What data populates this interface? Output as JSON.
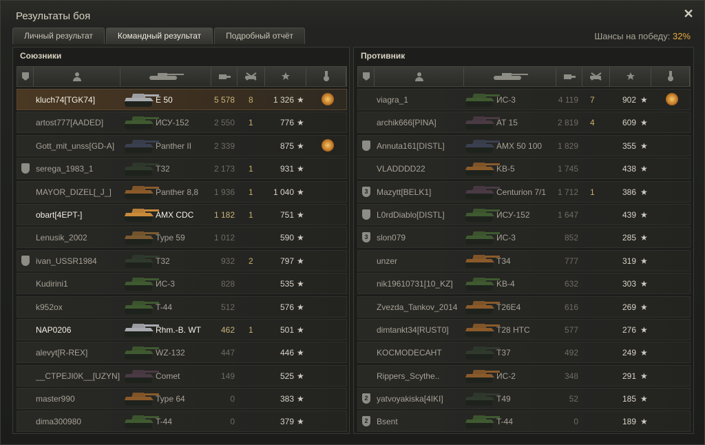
{
  "window": {
    "title": "Результаты боя",
    "close_icon": "close-icon"
  },
  "tabs": [
    {
      "label": "Личный результат",
      "active": false
    },
    {
      "label": "Командный результат",
      "active": true
    },
    {
      "label": "Подробный отчёт",
      "active": false
    }
  ],
  "win_chance": {
    "label": "Шансы на победу:",
    "value": "32%"
  },
  "allies": {
    "title": "Союзники",
    "rows": [
      {
        "name": "kluch74[TGK74]",
        "vehicle": "E 50",
        "damage": "5 578",
        "kills": "8",
        "xp": "1 326",
        "highlight": "self",
        "medal": true,
        "tank_color": "#a8aab0"
      },
      {
        "name": "artost777[AADED]",
        "vehicle": "ИСУ-152",
        "damage": "2 550",
        "kills": "1",
        "xp": "776",
        "tank_color": "#3f5a30"
      },
      {
        "name": "Gott_mit_unss[GD-A]",
        "vehicle": "Panther II",
        "damage": "2 339",
        "kills": "",
        "xp": "875",
        "medal": true,
        "tank_color": "#3a4050"
      },
      {
        "name": "serega_1983_1",
        "vehicle": "T32",
        "damage": "2 173",
        "kills": "1",
        "xp": "931",
        "badge": " ",
        "tank_color": "#2f3a2c"
      },
      {
        "name": "MAYOR_DIZEL[_J_]",
        "vehicle": "Panther 8,8",
        "damage": "1 936",
        "kills": "1",
        "xp": "1 040",
        "tank_color": "#8a5a2a"
      },
      {
        "name": "obart[4EPT-]",
        "vehicle": "AMX CDC",
        "damage": "1 182",
        "kills": "1",
        "xp": "751",
        "highlight": "bright",
        "tank_color": "#c98a3a"
      },
      {
        "name": "Lenusik_2002",
        "vehicle": "Type 59",
        "damage": "1 012",
        "kills": "",
        "xp": "590",
        "tank_color": "#7a5a30"
      },
      {
        "name": "ivan_USSR1984",
        "vehicle": "T32",
        "damage": "932",
        "kills": "2",
        "xp": "797",
        "badge": " ",
        "tank_color": "#2f3a2c"
      },
      {
        "name": "Kudirini1",
        "vehicle": "ИС-3",
        "damage": "828",
        "kills": "",
        "xp": "535",
        "tank_color": "#3f5a30"
      },
      {
        "name": "k952ox",
        "vehicle": "T-44",
        "damage": "512",
        "kills": "",
        "xp": "576",
        "tank_color": "#3f5a30"
      },
      {
        "name": "NAP0206",
        "vehicle": "Rhm.-B. WT",
        "damage": "462",
        "kills": "1",
        "xp": "501",
        "highlight": "bright",
        "tank_color": "#a8aab0"
      },
      {
        "name": "alevyt[R-REX]",
        "vehicle": "WZ-132",
        "damage": "447",
        "kills": "",
        "xp": "446",
        "tank_color": "#3f5a30"
      },
      {
        "name": "__CTPEJI0K__[UZYN]",
        "vehicle": "Comet",
        "damage": "149",
        "kills": "",
        "xp": "525",
        "tank_color": "#4a3a44"
      },
      {
        "name": "master990",
        "vehicle": "Type 64",
        "damage": "0",
        "kills": "",
        "xp": "383",
        "tank_color": "#8a5a2a"
      },
      {
        "name": "dima300980",
        "vehicle": "T-44",
        "damage": "0",
        "kills": "",
        "xp": "379",
        "tank_color": "#3f5a30"
      }
    ]
  },
  "enemies": {
    "title": "Противник",
    "rows": [
      {
        "name": "viagra_1",
        "vehicle": "ИС-3",
        "damage": "4 119",
        "kills": "7",
        "xp": "902",
        "medal": true,
        "tank_color": "#3f5a30"
      },
      {
        "name": "archik666[PINA]",
        "vehicle": "AT 15",
        "damage": "2 819",
        "kills": "4",
        "xp": "609",
        "tank_color": "#4a3a44"
      },
      {
        "name": "Annuta161[DISTL]",
        "vehicle": "AMX 50 100",
        "damage": "1 829",
        "kills": "",
        "xp": "355",
        "badge": " ",
        "tank_color": "#3a4050"
      },
      {
        "name": "VLADDDD22",
        "vehicle": "KB-5",
        "damage": "1 745",
        "kills": "",
        "xp": "438",
        "tank_color": "#8a5a2a"
      },
      {
        "name": "Mazytt[BELK1]",
        "vehicle": "Centurion 7/1",
        "damage": "1 712",
        "kills": "1",
        "xp": "386",
        "badge": "3",
        "tank_color": "#4a3a44"
      },
      {
        "name": "L0rdDiablo[DISTL]",
        "vehicle": "ИСУ-152",
        "damage": "1 647",
        "kills": "",
        "xp": "439",
        "badge": " ",
        "tank_color": "#3f5a30"
      },
      {
        "name": "slon079",
        "vehicle": "ИС-3",
        "damage": "852",
        "kills": "",
        "xp": "285",
        "badge": "3",
        "tank_color": "#3f5a30"
      },
      {
        "name": "unzer",
        "vehicle": "T34",
        "damage": "777",
        "kills": "",
        "xp": "319",
        "tank_color": "#8a5a2a"
      },
      {
        "name": "nik19610731[10_KZ]",
        "vehicle": "KB-4",
        "damage": "632",
        "kills": "",
        "xp": "303",
        "tank_color": "#3f5a30"
      },
      {
        "name": "Zvezda_Tankov_2014",
        "vehicle": "T26E4",
        "damage": "616",
        "kills": "",
        "xp": "269",
        "tank_color": "#8a5a2a"
      },
      {
        "name": "dimtankt34[RUST0]",
        "vehicle": "T28 HTC",
        "damage": "577",
        "kills": "",
        "xp": "276",
        "tank_color": "#8a5a2a"
      },
      {
        "name": "KOCMODECAHT",
        "vehicle": "T37",
        "damage": "492",
        "kills": "",
        "xp": "249",
        "tank_color": "#2f3a2c"
      },
      {
        "name": "Rippers_Scythe..",
        "vehicle": "ИС-2",
        "damage": "348",
        "kills": "",
        "xp": "291",
        "tank_color": "#8a5a2a"
      },
      {
        "name": "yatvoyakiska[4IKI]",
        "vehicle": "T49",
        "damage": "52",
        "kills": "",
        "xp": "185",
        "badge": "2",
        "tank_color": "#2f3a2c"
      },
      {
        "name": "Bsent",
        "vehicle": "T-44",
        "damage": "0",
        "kills": "",
        "xp": "189",
        "badge": "2",
        "tank_color": "#3f5a30"
      }
    ]
  },
  "icons": {
    "header": [
      "badge-icon",
      "player-icon",
      "tank-icon",
      "damage-icon",
      "kills-icon",
      "xp-star-icon",
      "medal-icon"
    ],
    "row_star": "★"
  },
  "colors": {
    "accent": "#e8a942",
    "self_row": "#4a3823"
  }
}
